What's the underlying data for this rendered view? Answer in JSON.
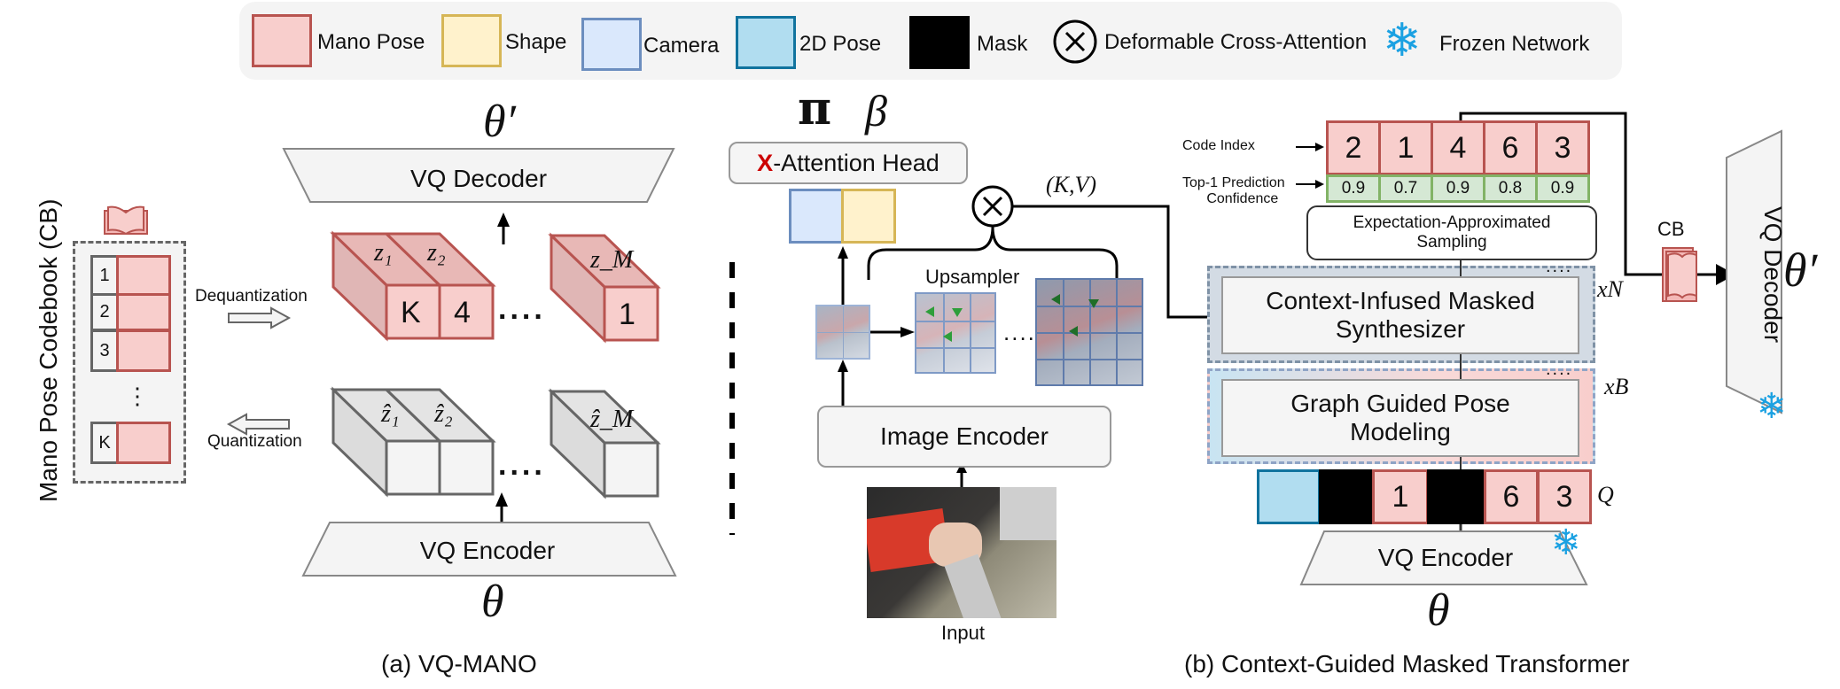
{
  "legend": {
    "items": [
      {
        "label": "Mano Pose",
        "fill": "#f8cecc",
        "stroke": "#b85450"
      },
      {
        "label": "Shape",
        "fill": "#fff2cc",
        "stroke": "#d6b656"
      },
      {
        "label": "Camera",
        "fill": "#dae8fc",
        "stroke": "#6c8ebf"
      },
      {
        "label": "2D Pose",
        "fill": "#b1ddf0",
        "stroke": "#10739e"
      },
      {
        "label": "Mask",
        "fill": "#000000",
        "stroke": "#000000"
      }
    ],
    "cross_attention_label": "Deformable Cross-Attention",
    "frozen_label": "Frozen Network"
  },
  "vq_mano": {
    "codebook_title": "Mano Pose Codebook (CB)",
    "codebook_indices": [
      "1",
      "2",
      "3",
      "⋮",
      "K"
    ],
    "dequantization_label": "Dequantization",
    "quantization_label": "Quantization",
    "decoder_label": "VQ Decoder",
    "encoder_label": "VQ Encoder",
    "theta_prime": "θ′",
    "theta": "θ",
    "quantized_tokens": [
      {
        "name": "z₁",
        "value": "K"
      },
      {
        "name": "z₂",
        "value": "4"
      },
      {
        "name": "z_M",
        "value": "1"
      }
    ],
    "latent_tokens": [
      "ẑ₁",
      "ẑ₂",
      "ẑ_M"
    ],
    "ellipsis": "....",
    "caption": "(a) VQ-MANO"
  },
  "transformer": {
    "pi": "π",
    "beta": "β",
    "xattn_prefix": "X",
    "xattn_label": "-Attention Head",
    "kv_label": "(K,V)",
    "upsampler_label": "Upsampler",
    "image_encoder_label": "Image Encoder",
    "input_label": "Input",
    "code_index_label": "Code Index",
    "confidence_label_line1": "Top-1 Prediction",
    "confidence_label_line2": "Confidence",
    "code_indices": [
      "2",
      "1",
      "4",
      "6",
      "3"
    ],
    "confidences": [
      "0.9",
      "0.7",
      "0.9",
      "0.8",
      "0.9"
    ],
    "sampling_label_line1": "Expectation-Approximated",
    "sampling_label_line2": "Sampling",
    "synth_label_line1": "Context-Infused Masked",
    "synth_label_line2": "Synthesizer",
    "graph_label_line1": "Graph Guided Pose",
    "graph_label_line2": "Modeling",
    "xN": "xN",
    "xB": "xB",
    "Q": "Q",
    "query_tokens": [
      "",
      "",
      "1",
      "",
      "6",
      "3"
    ],
    "encoder_label": "VQ Encoder",
    "theta": "θ",
    "cb_label": "CB",
    "decoder_label": "VQ Decoder",
    "theta_prime": "θ′",
    "dots": "....",
    "caption": "(b) Context-Guided Masked Transformer"
  }
}
